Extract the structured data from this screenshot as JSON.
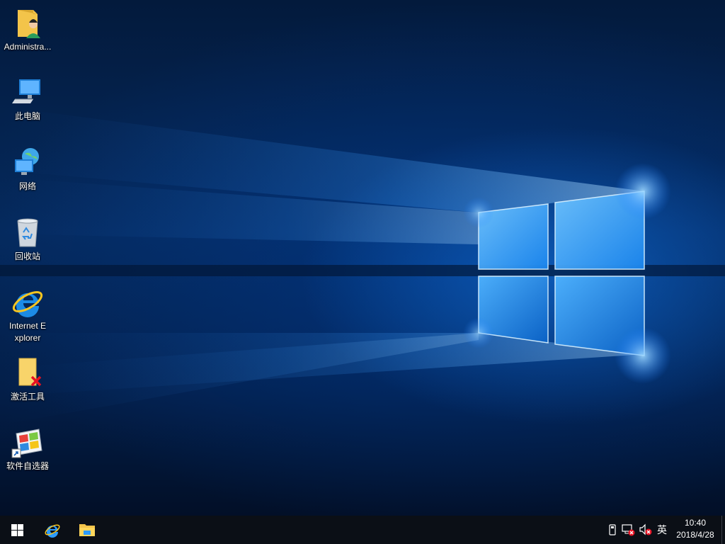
{
  "desktop": {
    "icons": [
      {
        "label": "Administra...",
        "icon": "user-folder-icon"
      },
      {
        "label": "此电脑",
        "icon": "computer-icon"
      },
      {
        "label": "网络",
        "icon": "network-icon"
      },
      {
        "label": "回收站",
        "icon": "recycle-bin-icon"
      },
      {
        "label": "Internet Explorer",
        "icon": "internet-explorer-icon"
      },
      {
        "label": "激活工具",
        "icon": "activation-tool-icon"
      },
      {
        "label": "软件自选器",
        "icon": "software-selector-icon"
      }
    ]
  },
  "taskbar": {
    "pinned": [
      "start-icon",
      "internet-explorer-icon",
      "file-explorer-icon"
    ],
    "tray": {
      "icons": [
        "removable-drive-icon",
        "network-disconnected-icon",
        "volume-muted-icon"
      ],
      "ime": "英"
    },
    "clock": {
      "time": "10:40",
      "date": "2018/4/28"
    }
  },
  "colors": {
    "taskbar": "#0b0f16",
    "accent": "#2c9bff",
    "error_badge": "#e81123"
  }
}
